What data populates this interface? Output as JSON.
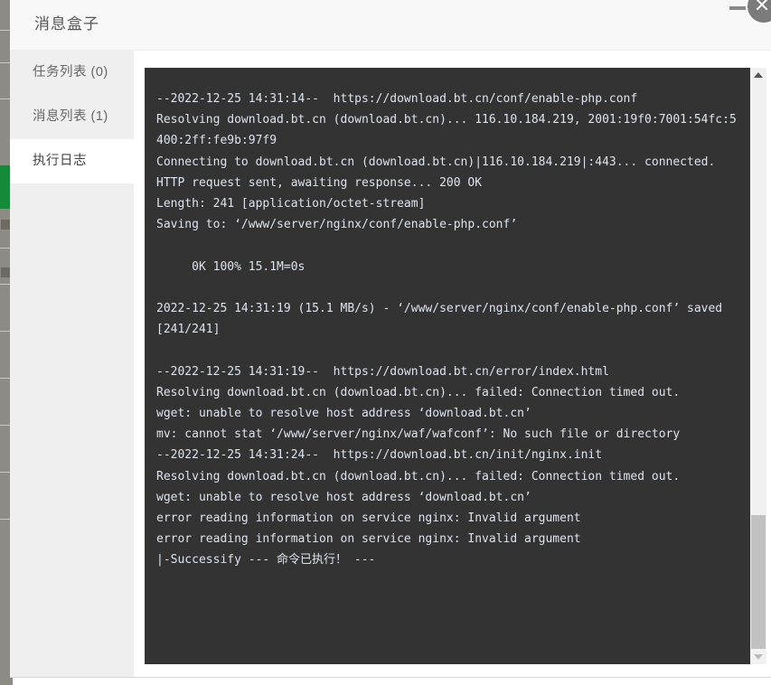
{
  "dialog": {
    "title": "消息盒子",
    "close_label": "×"
  },
  "nav": {
    "items": [
      {
        "label": "任务列表 (0)",
        "name": "task-list",
        "active": false
      },
      {
        "label": "消息列表 (1)",
        "name": "message-list",
        "active": false
      },
      {
        "label": "执行日志",
        "name": "execution-log",
        "active": true
      }
    ]
  },
  "log": {
    "content": "--2022-12-25 14:31:14--  https://download.bt.cn/conf/enable-php.conf\nResolving download.bt.cn (download.bt.cn)... 116.10.184.219, 2001:19f0:7001:54fc:5400:2ff:fe9b:97f9\nConnecting to download.bt.cn (download.bt.cn)|116.10.184.219|:443... connected.\nHTTP request sent, awaiting response... 200 OK\nLength: 241 [application/octet-stream]\nSaving to: ‘/www/server/nginx/conf/enable-php.conf’\n\n     0K 100% 15.1M=0s\n\n2022-12-25 14:31:19 (15.1 MB/s) - ‘/www/server/nginx/conf/enable-php.conf’ saved [241/241]\n\n--2022-12-25 14:31:19--  https://download.bt.cn/error/index.html\nResolving download.bt.cn (download.bt.cn)... failed: Connection timed out.\nwget: unable to resolve host address ‘download.bt.cn’\nmv: cannot stat ‘/www/server/nginx/waf/wafconf’: No such file or directory\n--2022-12-25 14:31:24--  https://download.bt.cn/init/nginx.init\nResolving download.bt.cn (download.bt.cn)... failed: Connection timed out.\nwget: unable to resolve host address ‘download.bt.cn’\nerror reading information on service nginx: Invalid argument\nerror reading information on service nginx: Invalid argument\n|-Successify --- 命令已执行！ ---",
    "scroll": {
      "up_arrow": "▲",
      "down_arrow": "▼"
    }
  },
  "colors": {
    "console_bg": "#333333",
    "console_text": "#dde3ef",
    "nav_bg": "#efefef",
    "nav_active_bg": "#ffffff",
    "header_bg": "#f8f8f8",
    "accent_green": "#158a3b",
    "scrollbar_track": "#f1f1f1",
    "scrollbar_thumb": "#c1c1c1"
  }
}
